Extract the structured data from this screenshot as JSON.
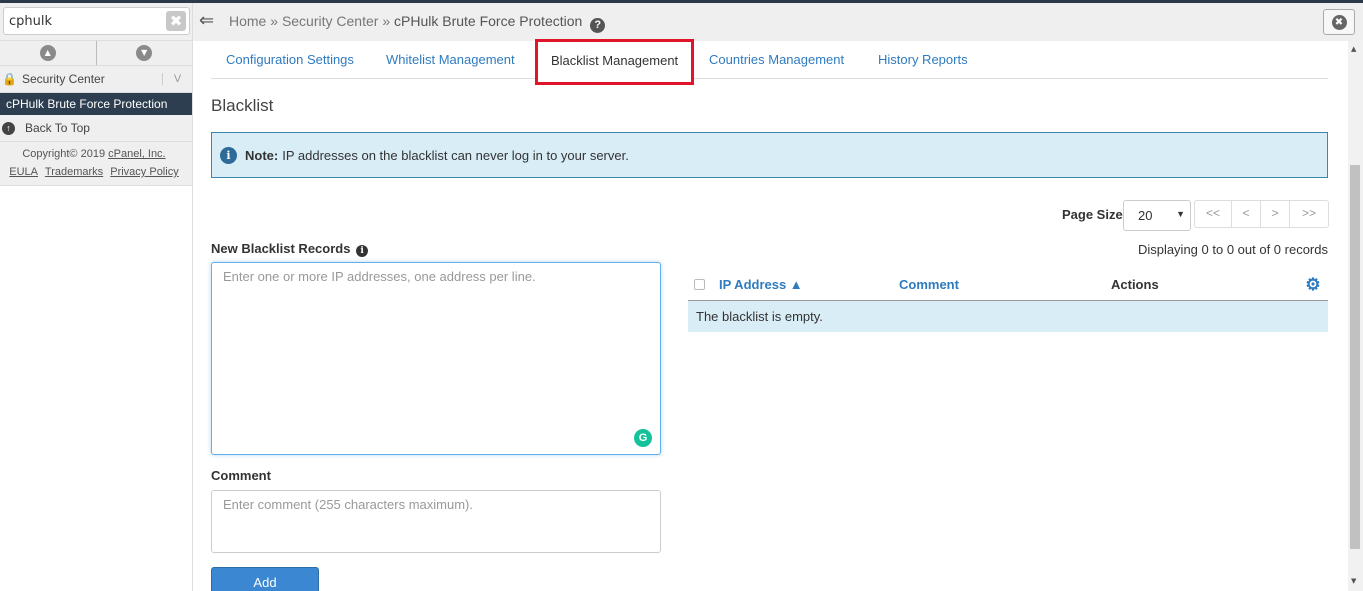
{
  "sidebar": {
    "search_value": "cphulk",
    "clear_symbol": "✖",
    "collapse_up": "▲",
    "collapse_down": "▼",
    "section_label": "Security Center",
    "section_chevron": "V",
    "active_item": "cPHulk Brute Force Protection",
    "back_to_top": "Back To Top",
    "footer": {
      "copyright_prefix": "Copyright© 2019",
      "company": "cPanel, Inc.",
      "links": [
        "EULA",
        "Trademarks",
        "Privacy Policy"
      ]
    }
  },
  "breadcrumb": {
    "home": "Home",
    "separator": "»",
    "section": "Security Center",
    "current": "cPHulk Brute Force Protection",
    "help": "?"
  },
  "header": {
    "close_symbol": "✖"
  },
  "tabs": [
    {
      "label": "Configuration Settings"
    },
    {
      "label": "Whitelist Management"
    },
    {
      "label": "Blacklist Management",
      "active": true
    },
    {
      "label": "Countries Management"
    },
    {
      "label": "History Reports"
    }
  ],
  "page": {
    "heading": "Blacklist",
    "note_title": "Note:",
    "note_text": "IP addresses on the blacklist can never log in to your server."
  },
  "pagination": {
    "page_size_label": "Page Size",
    "page_size_value": "20",
    "first": "<<",
    "prev": "<",
    "next": ">",
    "last": ">>"
  },
  "form": {
    "records_label": "New Blacklist Records",
    "records_placeholder": "Enter one or more IP addresses, one address per line.",
    "comment_label": "Comment",
    "comment_placeholder": "Enter comment (255 characters maximum).",
    "add_label": "Add"
  },
  "table": {
    "display_count": "Displaying 0 to 0 out of 0 records",
    "columns": [
      "IP Address ▲",
      "Comment",
      "Actions"
    ],
    "empty_text": "The blacklist is empty."
  },
  "colors": {
    "accent": "#2f7bbf",
    "active_tab_highlight": "#e0142a",
    "note_background": "#d9edf7",
    "sidebar_active": "#2d3e50",
    "button": "#3c87d2"
  }
}
